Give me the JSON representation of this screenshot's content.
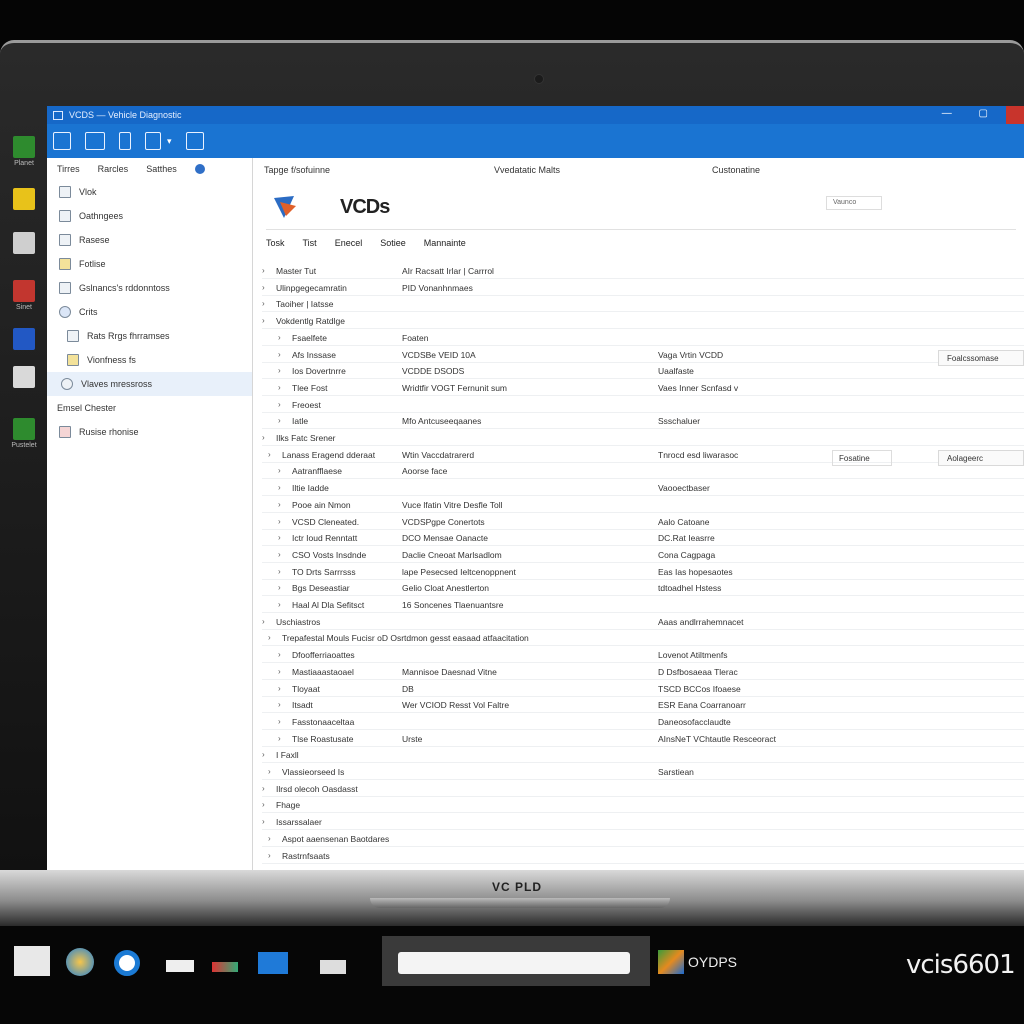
{
  "window": {
    "title": "VCDS — Vehicle Diagnostic"
  },
  "desktop": {
    "icons": [
      {
        "label": "Planet",
        "color": "#2e8b2e"
      },
      {
        "label": "",
        "color": "#e8c21a"
      },
      {
        "label": "",
        "color": "#cfcfcf"
      },
      {
        "label": "Sinet",
        "color": "#c2362f"
      },
      {
        "label": "",
        "color": "#2258c4"
      },
      {
        "label": "",
        "color": "#d9d9d9"
      },
      {
        "label": "Pustelet",
        "color": "#2e8b2e"
      }
    ]
  },
  "sidebar": {
    "tabs": [
      "Tirres",
      "Rarcles",
      "Satthes"
    ],
    "items": [
      {
        "label": "Vlok"
      },
      {
        "label": "Oathngees"
      },
      {
        "label": "Rasese"
      },
      {
        "label": "Fotlise"
      },
      {
        "label": "Gslnancs's rddonntoss"
      },
      {
        "label": "Crits"
      },
      {
        "label": "Rats Rrgs fhrramses"
      },
      {
        "label": "Vionfness fs"
      },
      {
        "label": "Vlaves mressross"
      },
      {
        "label": "Emsel Chester"
      },
      {
        "label": "Rusise rhonise"
      }
    ]
  },
  "main": {
    "header": {
      "left": "Tapge f/sofuinne",
      "center": "Vvedatatic Malts",
      "right": "Custonatine"
    },
    "logo_text": "VCDs",
    "logo_dropdown": "Vaunco",
    "menu": [
      "Tosk",
      "Tist",
      "Enecel",
      "Sotiee",
      "Mannainte"
    ],
    "rows": [
      {
        "c1": "Master  Tut",
        "c2": "AIr Racsatt  Irlar  |  Carrrol"
      },
      {
        "c1": "Ulinpgegecamratin",
        "c2": "PID Vonanhnmaes"
      },
      {
        "c1": "Taoiher  |  Iatsse"
      },
      {
        "c1": "Vokdentlg Ratdlge"
      },
      {
        "c1": "Fsaelfete",
        "c2": "Foaten"
      },
      {
        "c1": "Afs Inssase",
        "c2": "VCDSBe VEID  10A",
        "c3": "Vaga Vrtin VCDD",
        "btn": "Foalcssomase"
      },
      {
        "c1": "Ios Dovertnrre",
        "c2": "VCDDE DSODS",
        "c3": "Uaalfaste"
      },
      {
        "c1": "Tlee Fost",
        "c2": "Wridtfir VOGT Fernunit sum",
        "c3": "Vaes Inner Scnfasd v"
      },
      {
        "c1": "Freoest"
      },
      {
        "c1": "Iatle",
        "c2": "Mfo Antcuseeqaanes",
        "c3": "Ssschaluer"
      },
      {
        "c1": "Ilks Fatc  Srener"
      },
      {
        "c1": "Lanass Eragend dderaat",
        "c2": "Wtin Vaccdatrarerd",
        "c3": "Tnrocd esd liwarasoc",
        "sel": "Fosatine",
        "btn": "Aolageerc"
      },
      {
        "c1": "Aatranfflaese",
        "c2": "Aoorse face"
      },
      {
        "c1": "Iltie Iadde",
        "c3": "Vaooectbaser"
      },
      {
        "c1": "Pooe ain Nmon",
        "c2": "Vuce lfatin Vitre Desfle Toll"
      },
      {
        "c1": "VCSD Cleneated.",
        "c2": "VCDSPgpe Conertots",
        "c3": "Aalo Catoane"
      },
      {
        "c1": "Ictr Ioud Renntatt",
        "c2": "DCO Mensae Oanacte",
        "c3": "DC.Rat Ieasrre"
      },
      {
        "c1": "CSO Vosts Insdnde",
        "c2": "Daclie Cneoat  Marlsadlom",
        "c3": "Cona Cagpaga"
      },
      {
        "c1": "TO  Drts Sarrrsss",
        "c2": "lape Pesecsed Ieltcenoppnent",
        "c3": "Eas Ias hopesaotes"
      },
      {
        "c1": "Bgs Deseastiar",
        "c2": "Gelio Cloat Anestlerton",
        "c3": "tdtoadhel Hstess"
      },
      {
        "c1": "Haal Al Dla Sefitsct",
        "c2": "16  Soncenes  Tlaenuantsre"
      },
      {
        "c1": "Uschiastros",
        "c3": "Aaas andlrrahemnacet"
      },
      {
        "c1": "Trepafestal Mouls Fucisr oD Osrtdmon gesst easaad atfaacitation"
      },
      {
        "c1": "Dfoofferriaoattes",
        "c3": "Lovenot Atiltmenfs"
      },
      {
        "c1": "Mastiaaastaoael",
        "c2": "Mannisoe Daesnad Vitne",
        "c3": "D Dsfbosaeaa Tlerac"
      },
      {
        "c1": "Tloyaat",
        "c2": "DB",
        "c3": "TSCD BCCos Ifoaese"
      },
      {
        "c1": "Itsadt",
        "c2": "Wer VCIOD Resst  Vol Faltre",
        "c3": "ESR Eana Coarranoarr"
      },
      {
        "c1": "Fasstonaaceltaa",
        "c3": "Daneosofacclaudte"
      },
      {
        "c1": "Tlse Roastusate",
        "c2": "Urste",
        "c3": "AInsNeT VChtautle Resceoract"
      },
      {
        "c1": "I Faxll"
      },
      {
        "c1": "Vlassieorseed Is",
        "c3": "Sarstiean"
      },
      {
        "c1": "Ilrsd olecoh Oasdasst"
      },
      {
        "c1": "Fhage"
      },
      {
        "c1": "Issarssalaer"
      },
      {
        "c1": "Aspot aaensenan Baotdares"
      },
      {
        "c1": "Rastrnfsaats"
      }
    ]
  },
  "bezel": {
    "brand": "VC PLD"
  },
  "taskbar": {
    "app_label": "OYDPS",
    "corner_brand": "vcis6601"
  }
}
